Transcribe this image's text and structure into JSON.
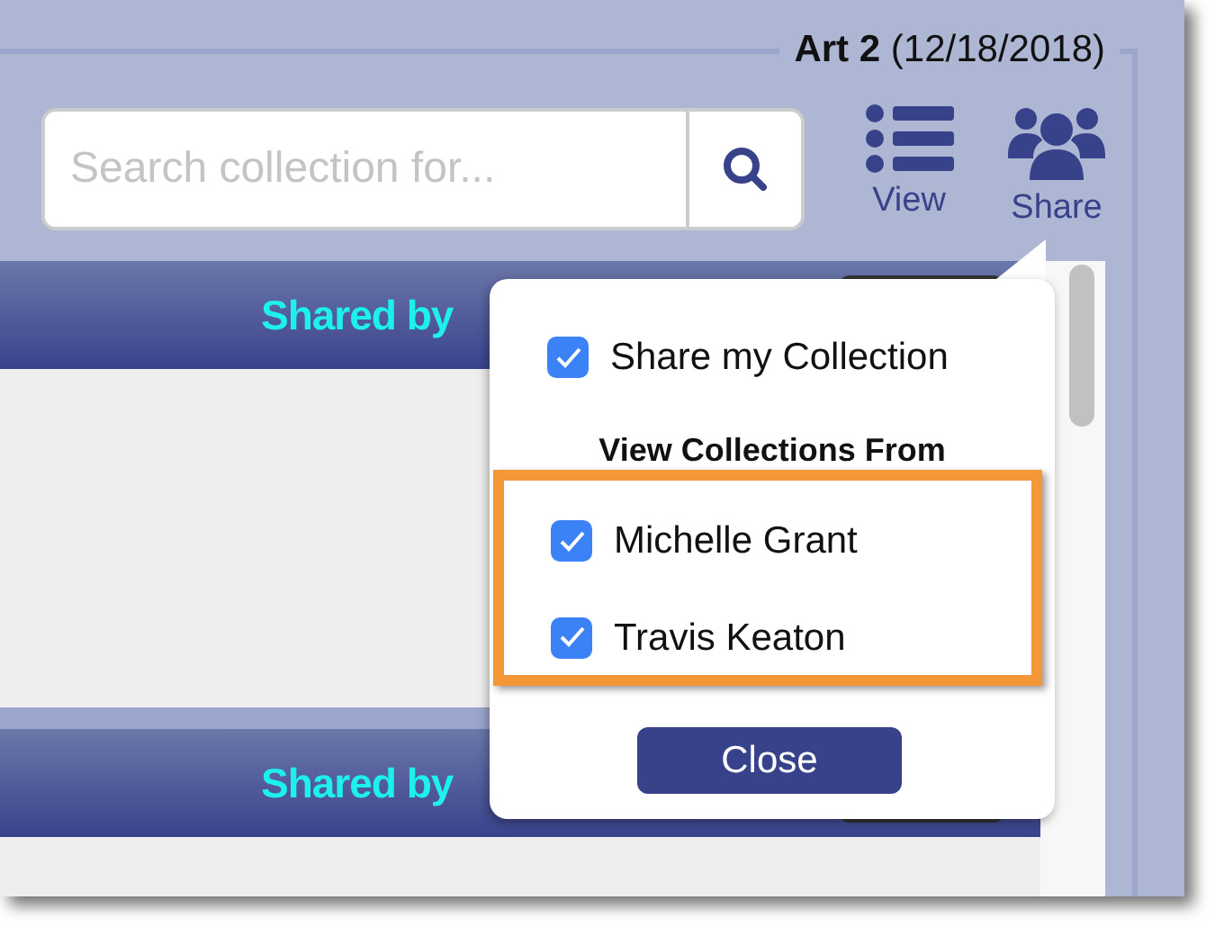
{
  "header": {
    "title": "Art 2",
    "date": "(12/18/2018)"
  },
  "search": {
    "placeholder": "Search collection for..."
  },
  "toolbar": [
    {
      "kind": "view",
      "label": "View"
    },
    {
      "kind": "share",
      "label": "Share"
    }
  ],
  "sections": [
    {
      "title": "Shared by"
    },
    {
      "title": "Shared by"
    }
  ],
  "share_popover": {
    "share_option": {
      "label": "Share my Collection",
      "checked": true
    },
    "heading": "View Collections From",
    "people": [
      {
        "label": "Michelle Grant",
        "checked": true
      },
      {
        "label": "Travis Keaton",
        "checked": true
      }
    ],
    "close_button": "Close"
  }
}
